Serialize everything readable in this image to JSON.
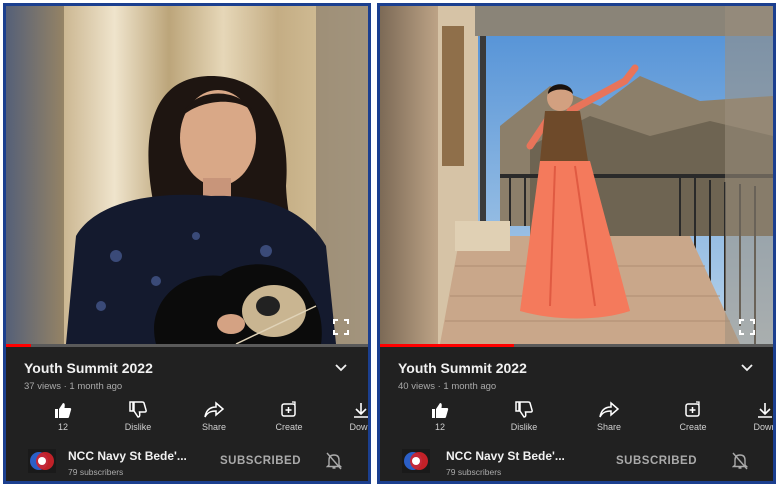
{
  "panels": [
    {
      "title": "Youth Summit 2022",
      "views": "37 views · 1 month ago",
      "progress": 0.07,
      "actions": [
        {
          "icon": "thumbs-up-icon",
          "label": "12"
        },
        {
          "icon": "thumbs-down-icon",
          "label": "Dislike"
        },
        {
          "icon": "share-icon",
          "label": "Share"
        },
        {
          "icon": "create-icon",
          "label": "Create"
        },
        {
          "icon": "download-icon",
          "label": "Down"
        }
      ],
      "channel": {
        "name": "NCC Navy St Bede'...",
        "subscribers": "79 subscribers",
        "subscribe_label": "SUBSCRIBED"
      }
    },
    {
      "title": "Youth Summit 2022",
      "views": "40 views · 1 month ago",
      "progress": 0.34,
      "actions": [
        {
          "icon": "thumbs-up-icon",
          "label": "12"
        },
        {
          "icon": "thumbs-down-icon",
          "label": "Dislike"
        },
        {
          "icon": "share-icon",
          "label": "Share"
        },
        {
          "icon": "create-icon",
          "label": "Create"
        },
        {
          "icon": "download-icon",
          "label": "Down"
        }
      ],
      "channel": {
        "name": "NCC Navy St Bede'...",
        "subscribers": "79 subscribers",
        "subscribe_label": "SUBSCRIBED"
      }
    }
  ],
  "colors": {
    "border": "#1b3f8f",
    "background": "#212121",
    "progress": "#ff0000"
  }
}
